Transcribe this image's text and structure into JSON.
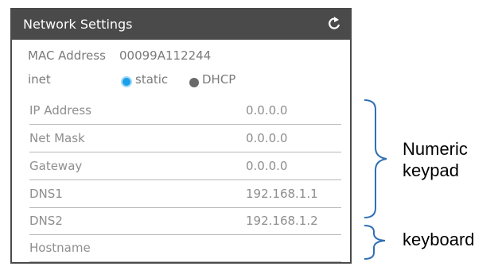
{
  "window": {
    "title": "Network Settings",
    "refresh_icon": "refresh-icon"
  },
  "mac": {
    "label": "MAC Address",
    "value": "00099A112244"
  },
  "inet": {
    "label": "inet",
    "options": [
      {
        "label": "static",
        "selected": true
      },
      {
        "label": "DHCP",
        "selected": false
      }
    ]
  },
  "fields": [
    {
      "label": "IP Address",
      "value": "0.0.0.0"
    },
    {
      "label": "Net Mask",
      "value": "0.0.0.0"
    },
    {
      "label": "Gateway",
      "value": "0.0.0.0"
    },
    {
      "label": "DNS1",
      "value": "192.168.1.1"
    },
    {
      "label": "DNS2",
      "value": "192.168.1.2"
    },
    {
      "label": "Hostname",
      "value": ""
    }
  ],
  "annotations": {
    "numeric_line1": "Numeric",
    "numeric_line2": "keypad",
    "keyboard": "keyboard"
  },
  "colors": {
    "titlebar": "#4a4a4a",
    "radio_selected": "#1aa0e8",
    "radio_unselected": "#6a6a6a"
  }
}
